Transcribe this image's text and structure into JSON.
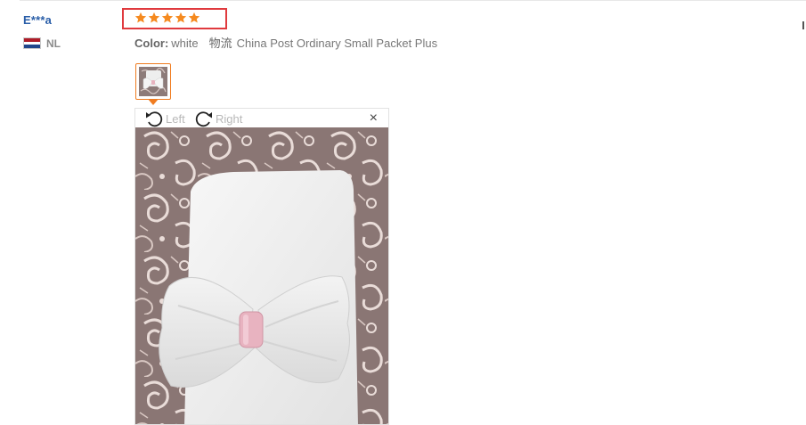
{
  "review": {
    "buyer_name": "E***a",
    "country_code": "NL",
    "flag_colors": [
      "#ae1c28",
      "#ffffff",
      "#21468b"
    ],
    "rating": 5,
    "rating_max": 5,
    "star_color": "#f58a1f",
    "highlight_color": "#e03a3e",
    "color_label": "Color:",
    "color_value": "white",
    "shipping_label": "物流",
    "shipping_value": "China Post Ordinary Small Packet Plus",
    "photo_count": 1
  },
  "viewer": {
    "rotate_left_label": "Left",
    "rotate_right_label": "Right",
    "close_glyph": "×",
    "icons": [
      "rotate-left-icon",
      "rotate-right-icon",
      "close-icon"
    ],
    "image_subject": "white knit baby hat with bow on paisley fabric"
  }
}
